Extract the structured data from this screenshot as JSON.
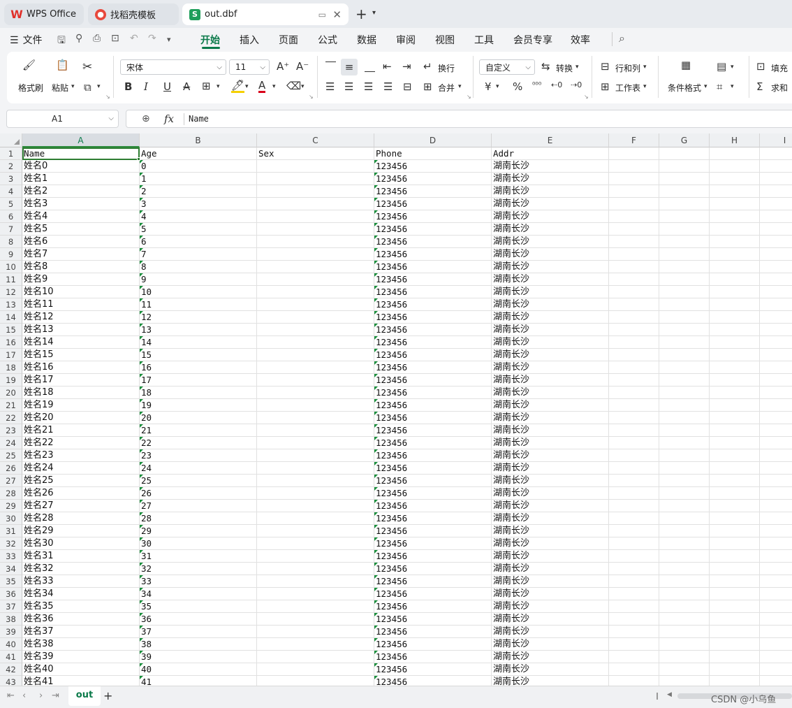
{
  "titlebar": {
    "tabs": [
      {
        "label": "WPS Office"
      },
      {
        "label": "找稻壳模板"
      },
      {
        "label": "out.dbf"
      }
    ]
  },
  "menu": {
    "file": "文件",
    "items": [
      "开始",
      "插入",
      "页面",
      "公式",
      "数据",
      "审阅",
      "视图",
      "工具",
      "会员专享",
      "效率"
    ]
  },
  "ribbon": {
    "format_painter": "格式刷",
    "paste": "粘贴",
    "font_name": "宋体",
    "font_size": "11",
    "wrap": "换行",
    "merge": "合并",
    "number_format": "自定义",
    "convert": "转换",
    "row_col": "行和列",
    "worksheet": "工作表",
    "cond_format": "条件格式",
    "fill": "填充",
    "sum": "求和",
    "currency_symbol": "¥",
    "percent_symbol": "%"
  },
  "formula_bar": {
    "cell_ref": "A1",
    "fx": "fx",
    "value": "Name"
  },
  "sheet": {
    "columns": [
      "A",
      "B",
      "C",
      "D",
      "E",
      "F",
      "G",
      "H",
      "I"
    ],
    "header_row": [
      "Name",
      "Age",
      "Sex",
      "Phone",
      "Addr"
    ],
    "rows": [
      [
        "姓名0",
        "0",
        "",
        "123456",
        "湖南长沙"
      ],
      [
        "姓名1",
        "1",
        "",
        "123456",
        "湖南长沙"
      ],
      [
        "姓名2",
        "2",
        "",
        "123456",
        "湖南长沙"
      ],
      [
        "姓名3",
        "3",
        "",
        "123456",
        "湖南长沙"
      ],
      [
        "姓名4",
        "4",
        "",
        "123456",
        "湖南长沙"
      ],
      [
        "姓名5",
        "5",
        "",
        "123456",
        "湖南长沙"
      ],
      [
        "姓名6",
        "6",
        "",
        "123456",
        "湖南长沙"
      ],
      [
        "姓名7",
        "7",
        "",
        "123456",
        "湖南长沙"
      ],
      [
        "姓名8",
        "8",
        "",
        "123456",
        "湖南长沙"
      ],
      [
        "姓名9",
        "9",
        "",
        "123456",
        "湖南长沙"
      ],
      [
        "姓名10",
        "10",
        "",
        "123456",
        "湖南长沙"
      ],
      [
        "姓名11",
        "11",
        "",
        "123456",
        "湖南长沙"
      ],
      [
        "姓名12",
        "12",
        "",
        "123456",
        "湖南长沙"
      ],
      [
        "姓名13",
        "13",
        "",
        "123456",
        "湖南长沙"
      ],
      [
        "姓名14",
        "14",
        "",
        "123456",
        "湖南长沙"
      ],
      [
        "姓名15",
        "15",
        "",
        "123456",
        "湖南长沙"
      ],
      [
        "姓名16",
        "16",
        "",
        "123456",
        "湖南长沙"
      ],
      [
        "姓名17",
        "17",
        "",
        "123456",
        "湖南长沙"
      ],
      [
        "姓名18",
        "18",
        "",
        "123456",
        "湖南长沙"
      ],
      [
        "姓名19",
        "19",
        "",
        "123456",
        "湖南长沙"
      ],
      [
        "姓名20",
        "20",
        "",
        "123456",
        "湖南长沙"
      ],
      [
        "姓名21",
        "21",
        "",
        "123456",
        "湖南长沙"
      ],
      [
        "姓名22",
        "22",
        "",
        "123456",
        "湖南长沙"
      ],
      [
        "姓名23",
        "23",
        "",
        "123456",
        "湖南长沙"
      ],
      [
        "姓名24",
        "24",
        "",
        "123456",
        "湖南长沙"
      ],
      [
        "姓名25",
        "25",
        "",
        "123456",
        "湖南长沙"
      ],
      [
        "姓名26",
        "26",
        "",
        "123456",
        "湖南长沙"
      ],
      [
        "姓名27",
        "27",
        "",
        "123456",
        "湖南长沙"
      ],
      [
        "姓名28",
        "28",
        "",
        "123456",
        "湖南长沙"
      ],
      [
        "姓名29",
        "29",
        "",
        "123456",
        "湖南长沙"
      ],
      [
        "姓名30",
        "30",
        "",
        "123456",
        "湖南长沙"
      ],
      [
        "姓名31",
        "31",
        "",
        "123456",
        "湖南长沙"
      ],
      [
        "姓名32",
        "32",
        "",
        "123456",
        "湖南长沙"
      ],
      [
        "姓名33",
        "33",
        "",
        "123456",
        "湖南长沙"
      ],
      [
        "姓名34",
        "34",
        "",
        "123456",
        "湖南长沙"
      ],
      [
        "姓名35",
        "35",
        "",
        "123456",
        "湖南长沙"
      ],
      [
        "姓名36",
        "36",
        "",
        "123456",
        "湖南长沙"
      ],
      [
        "姓名37",
        "37",
        "",
        "123456",
        "湖南长沙"
      ],
      [
        "姓名38",
        "38",
        "",
        "123456",
        "湖南长沙"
      ],
      [
        "姓名39",
        "39",
        "",
        "123456",
        "湖南长沙"
      ],
      [
        "姓名40",
        "40",
        "",
        "123456",
        "湖南长沙"
      ],
      [
        "姓名41",
        "41",
        "",
        "123456",
        "湖南长沙"
      ]
    ]
  },
  "sheet_tabs": {
    "active": "out",
    "add_label": "+"
  },
  "watermark": "CSDN @小乌鱼",
  "colors": {
    "accent": "#0b7a4a",
    "selection": "#2e7d32"
  }
}
